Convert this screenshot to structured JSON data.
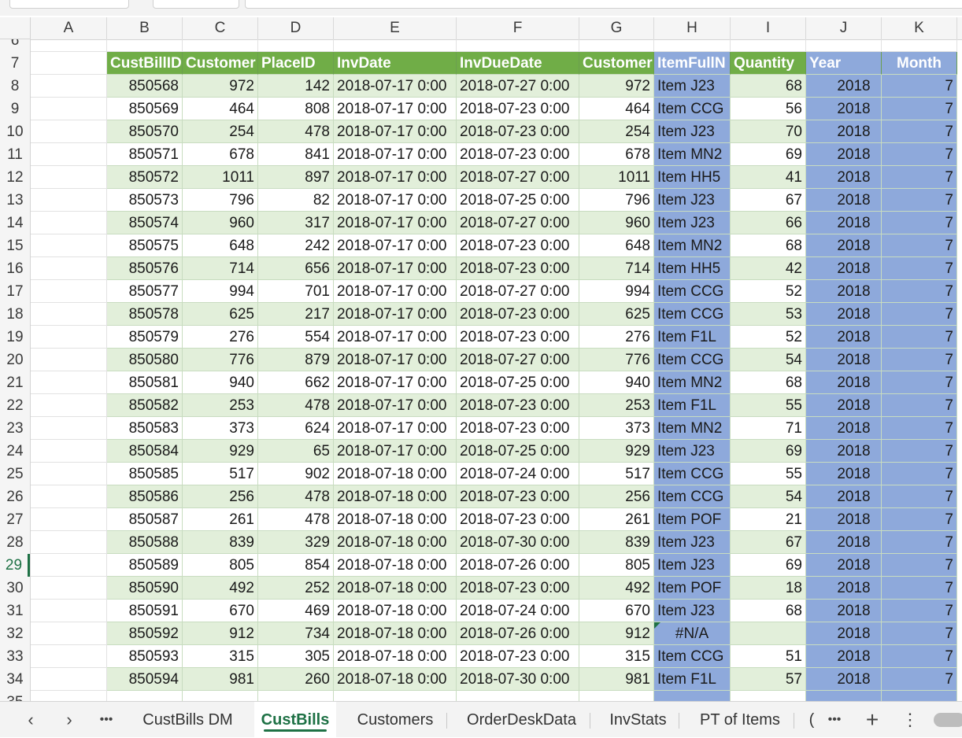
{
  "columns": [
    "A",
    "B",
    "C",
    "D",
    "E",
    "F",
    "G",
    "H",
    "I",
    "J",
    "K"
  ],
  "partial_top_row": "6",
  "active_row": "29",
  "header_row": {
    "row": "7",
    "cells": [
      "",
      "CustBillID",
      "Customer",
      "PlaceID",
      "InvDate",
      "InvDueDate",
      "Customer",
      "ItemFullN",
      "Quantity",
      "Year",
      "Month"
    ]
  },
  "rows": [
    {
      "r": "8",
      "v": [
        "850568",
        "972",
        "142",
        "2018-07-17 0:00",
        "2018-07-27 0:00",
        "972",
        "Item J23",
        "68",
        "2018",
        "7"
      ]
    },
    {
      "r": "9",
      "v": [
        "850569",
        "464",
        "808",
        "2018-07-17 0:00",
        "2018-07-23 0:00",
        "464",
        "Item CCG",
        "56",
        "2018",
        "7"
      ]
    },
    {
      "r": "10",
      "v": [
        "850570",
        "254",
        "478",
        "2018-07-17 0:00",
        "2018-07-23 0:00",
        "254",
        "Item J23",
        "70",
        "2018",
        "7"
      ]
    },
    {
      "r": "11",
      "v": [
        "850571",
        "678",
        "841",
        "2018-07-17 0:00",
        "2018-07-23 0:00",
        "678",
        "Item MN2",
        "69",
        "2018",
        "7"
      ]
    },
    {
      "r": "12",
      "v": [
        "850572",
        "1011",
        "897",
        "2018-07-17 0:00",
        "2018-07-27 0:00",
        "1011",
        "Item HH5",
        "41",
        "2018",
        "7"
      ]
    },
    {
      "r": "13",
      "v": [
        "850573",
        "796",
        "82",
        "2018-07-17 0:00",
        "2018-07-25 0:00",
        "796",
        "Item J23",
        "67",
        "2018",
        "7"
      ]
    },
    {
      "r": "14",
      "v": [
        "850574",
        "960",
        "317",
        "2018-07-17 0:00",
        "2018-07-27 0:00",
        "960",
        "Item J23",
        "66",
        "2018",
        "7"
      ]
    },
    {
      "r": "15",
      "v": [
        "850575",
        "648",
        "242",
        "2018-07-17 0:00",
        "2018-07-23 0:00",
        "648",
        "Item MN2",
        "68",
        "2018",
        "7"
      ]
    },
    {
      "r": "16",
      "v": [
        "850576",
        "714",
        "656",
        "2018-07-17 0:00",
        "2018-07-23 0:00",
        "714",
        "Item HH5",
        "42",
        "2018",
        "7"
      ]
    },
    {
      "r": "17",
      "v": [
        "850577",
        "994",
        "701",
        "2018-07-17 0:00",
        "2018-07-27 0:00",
        "994",
        "Item CCG",
        "52",
        "2018",
        "7"
      ]
    },
    {
      "r": "18",
      "v": [
        "850578",
        "625",
        "217",
        "2018-07-17 0:00",
        "2018-07-23 0:00",
        "625",
        "Item CCG",
        "53",
        "2018",
        "7"
      ]
    },
    {
      "r": "19",
      "v": [
        "850579",
        "276",
        "554",
        "2018-07-17 0:00",
        "2018-07-23 0:00",
        "276",
        "Item F1L",
        "52",
        "2018",
        "7"
      ]
    },
    {
      "r": "20",
      "v": [
        "850580",
        "776",
        "879",
        "2018-07-17 0:00",
        "2018-07-27 0:00",
        "776",
        "Item CCG",
        "54",
        "2018",
        "7"
      ]
    },
    {
      "r": "21",
      "v": [
        "850581",
        "940",
        "662",
        "2018-07-17 0:00",
        "2018-07-25 0:00",
        "940",
        "Item MN2",
        "68",
        "2018",
        "7"
      ]
    },
    {
      "r": "22",
      "v": [
        "850582",
        "253",
        "478",
        "2018-07-17 0:00",
        "2018-07-23 0:00",
        "253",
        "Item F1L",
        "55",
        "2018",
        "7"
      ]
    },
    {
      "r": "23",
      "v": [
        "850583",
        "373",
        "624",
        "2018-07-17 0:00",
        "2018-07-23 0:00",
        "373",
        "Item MN2",
        "71",
        "2018",
        "7"
      ]
    },
    {
      "r": "24",
      "v": [
        "850584",
        "929",
        "65",
        "2018-07-17 0:00",
        "2018-07-25 0:00",
        "929",
        "Item J23",
        "69",
        "2018",
        "7"
      ]
    },
    {
      "r": "25",
      "v": [
        "850585",
        "517",
        "902",
        "2018-07-18 0:00",
        "2018-07-24 0:00",
        "517",
        "Item CCG",
        "55",
        "2018",
        "7"
      ]
    },
    {
      "r": "26",
      "v": [
        "850586",
        "256",
        "478",
        "2018-07-18 0:00",
        "2018-07-23 0:00",
        "256",
        "Item CCG",
        "54",
        "2018",
        "7"
      ]
    },
    {
      "r": "27",
      "v": [
        "850587",
        "261",
        "478",
        "2018-07-18 0:00",
        "2018-07-23 0:00",
        "261",
        "Item POF",
        "21",
        "2018",
        "7"
      ]
    },
    {
      "r": "28",
      "v": [
        "850588",
        "839",
        "329",
        "2018-07-18 0:00",
        "2018-07-30 0:00",
        "839",
        "Item J23",
        "67",
        "2018",
        "7"
      ]
    },
    {
      "r": "29",
      "v": [
        "850589",
        "805",
        "854",
        "2018-07-18 0:00",
        "2018-07-26 0:00",
        "805",
        "Item J23",
        "69",
        "2018",
        "7"
      ]
    },
    {
      "r": "30",
      "v": [
        "850590",
        "492",
        "252",
        "2018-07-18 0:00",
        "2018-07-23 0:00",
        "492",
        "Item POF",
        "18",
        "2018",
        "7"
      ]
    },
    {
      "r": "31",
      "v": [
        "850591",
        "670",
        "469",
        "2018-07-18 0:00",
        "2018-07-24 0:00",
        "670",
        "Item J23",
        "68",
        "2018",
        "7"
      ]
    },
    {
      "r": "32",
      "v": [
        "850592",
        "912",
        "734",
        "2018-07-18 0:00",
        "2018-07-26 0:00",
        "912",
        "#N/A",
        "",
        "2018",
        "7"
      ]
    },
    {
      "r": "33",
      "v": [
        "850593",
        "315",
        "305",
        "2018-07-18 0:00",
        "2018-07-23 0:00",
        "315",
        "Item CCG",
        "51",
        "2018",
        "7"
      ]
    },
    {
      "r": "34",
      "v": [
        "850594",
        "981",
        "260",
        "2018-07-18 0:00",
        "2018-07-30 0:00",
        "981",
        "Item F1L",
        "57",
        "2018",
        "7"
      ]
    }
  ],
  "sheet_tabs": [
    {
      "label": "CustBills DM",
      "active": false
    },
    {
      "label": "CustBills",
      "active": true
    },
    {
      "label": "Customers",
      "active": false
    },
    {
      "label": "OrderDeskData",
      "active": false
    },
    {
      "label": "InvStats",
      "active": false
    },
    {
      "label": "PT of Items",
      "active": false
    },
    {
      "label": "(",
      "active": false
    }
  ],
  "tab_controls": {
    "prev": "‹",
    "next": "›",
    "more_left": "•••",
    "more_right": "•••",
    "add": "+",
    "options": "⋮"
  },
  "colors": {
    "green_header": "#70ad47",
    "green_band": "#e2efda",
    "blue_fill": "#8ea9db",
    "active_accent": "#1e7145"
  }
}
